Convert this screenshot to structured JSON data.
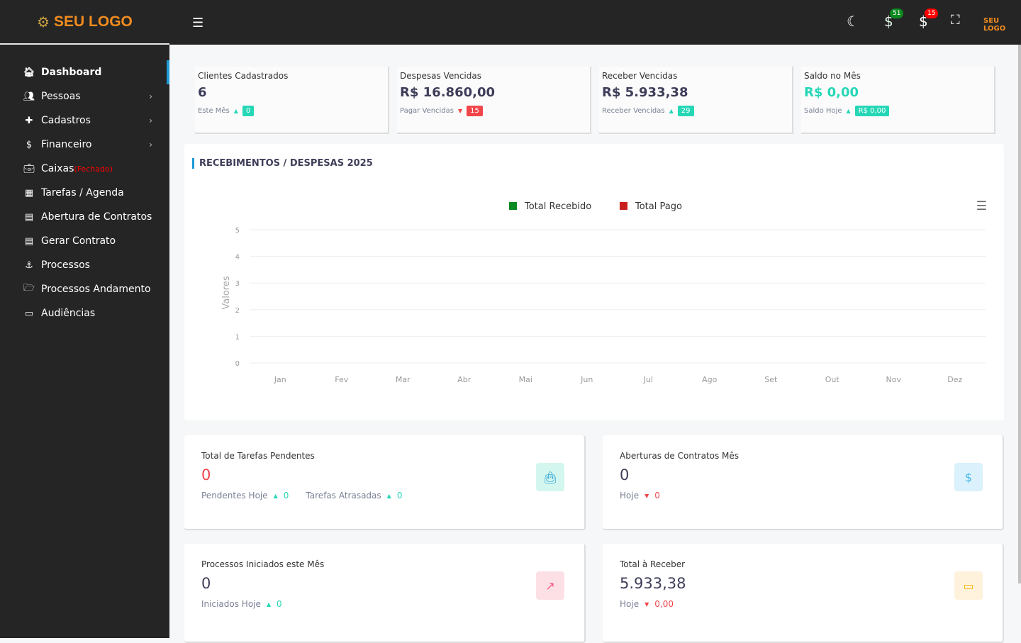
{
  "brand": {
    "logo_text": "SEU LOGO"
  },
  "sidebar": {
    "items": [
      {
        "label": "Dashboard",
        "icon": "home-icon",
        "active": true
      },
      {
        "label": "Pessoas",
        "icon": "users-icon",
        "submenu": true
      },
      {
        "label": "Cadastros",
        "icon": "plus-icon",
        "submenu": true
      },
      {
        "label": "Financeiro",
        "icon": "dollar-icon",
        "submenu": true
      },
      {
        "label": "Caixas",
        "note": "(Fechado)",
        "icon": "briefcase-icon"
      },
      {
        "label": "Tarefas / Agenda",
        "icon": "calendar-icon"
      },
      {
        "label": "Abertura de Contratos",
        "icon": "file-icon"
      },
      {
        "label": "Gerar Contrato",
        "icon": "file-icon"
      },
      {
        "label": "Processos",
        "icon": "anchor-icon"
      },
      {
        "label": "Processos Andamento",
        "icon": "folder-open-icon"
      },
      {
        "label": "Audiências",
        "icon": "calendar-blank-icon"
      }
    ]
  },
  "topbar": {
    "receber_badge": "51",
    "pagar_badge": "15",
    "logo_text": "SEU LOGO"
  },
  "stats": [
    {
      "title": "Clientes Cadastrados",
      "value": "6",
      "sub": "Este Mês",
      "dir": "up",
      "pill": "0",
      "pill_color": "#26d7b6"
    },
    {
      "title": "Despesas Vencidas",
      "value": "R$ 16.860,00",
      "sub": "Pagar Vencidas",
      "dir": "down",
      "pill": "15",
      "pill_color": "#f0464b"
    },
    {
      "title": "Receber Vencidas",
      "value": "R$ 5.933,38",
      "sub": "Receber Vencidas",
      "dir": "up",
      "pill": "29",
      "pill_color": "#26d7b6"
    },
    {
      "title": "Saldo no Mês",
      "value": "R$ 0,00",
      "sub": "Saldo Hoje",
      "dir": "up",
      "pill": "R$ 0,00",
      "pill_color": "#26d7b6"
    }
  ],
  "chart_title": "RECEBIMENTOS / DESPESAS 2025",
  "chart_data": {
    "type": "line",
    "categories": [
      "Jan",
      "Fev",
      "Mar",
      "Abr",
      "Mai",
      "Jun",
      "Jul",
      "Ago",
      "Set",
      "Out",
      "Nov",
      "Dez"
    ],
    "series": [
      {
        "name": "Total Recebido",
        "color": "#0a8a1f",
        "values": []
      },
      {
        "name": "Total Pago",
        "color": "#c8201e",
        "values": []
      }
    ],
    "ylabel": "Valores",
    "ylim": [
      0,
      5
    ],
    "yticks": [
      0,
      1,
      2,
      3,
      4,
      5
    ],
    "grid": true,
    "legend": "top"
  },
  "cards": [
    {
      "title": "Total de Tarefas Pendentes",
      "value": "0",
      "value_color": "#f0464b",
      "subs": [
        {
          "label": "Pendentes Hoje",
          "dir": "up",
          "val": "0"
        },
        {
          "label": "Tarefas Atrasadas",
          "dir": "up",
          "val": "0"
        }
      ],
      "icon": "shopping-bag-icon",
      "icon_color": "#1e9ad6",
      "icon_bg": "#d3f7ee"
    },
    {
      "title": "Aberturas de Contratos Mês",
      "value": "0",
      "value_color": "#3e3e5a",
      "subs": [
        {
          "label": "Hoje",
          "dir": "down",
          "val": "0"
        }
      ],
      "icon": "dollar-icon",
      "icon_color": "#49b8e8",
      "icon_bg": "#dbf1fb"
    },
    {
      "title": "Processos Iniciados este Mês",
      "value": "0",
      "value_color": "#3e3e5a",
      "subs": [
        {
          "label": "Iniciados Hoje",
          "dir": "up",
          "val": "0"
        }
      ],
      "icon": "external-link-icon",
      "icon_color": "#f0567a",
      "icon_bg": "#fde0e6"
    },
    {
      "title": "Total à Receber",
      "value": "5.933,38",
      "value_color": "#3e3e5a",
      "subs": [
        {
          "label": "Hoje",
          "dir": "down",
          "val": "0,00"
        }
      ],
      "icon": "credit-card-icon",
      "icon_color": "#f6b800",
      "icon_bg": "#fff2dd"
    }
  ]
}
